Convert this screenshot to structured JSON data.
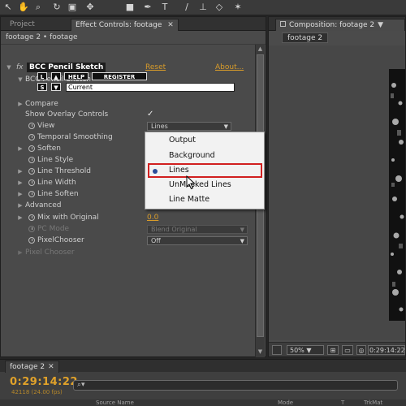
{
  "toolbar": {
    "tools": [
      {
        "icon": "selection-tool-icon",
        "glyph": "↖"
      },
      {
        "icon": "hand-tool-icon",
        "glyph": "✋"
      },
      {
        "icon": "zoom-tool-icon",
        "glyph": "⌕"
      },
      {
        "icon": "rotate-tool-icon",
        "glyph": "↻"
      },
      {
        "icon": "camera-tool-icon",
        "glyph": "▣"
      },
      {
        "icon": "pan-behind-tool-icon",
        "glyph": "✥"
      },
      {
        "icon": "rectangle-tool-icon",
        "glyph": "■"
      },
      {
        "icon": "pen-tool-icon",
        "glyph": "✒"
      },
      {
        "icon": "type-tool-icon",
        "glyph": "T"
      },
      {
        "icon": "brush-tool-icon",
        "glyph": "∕"
      },
      {
        "icon": "clone-stamp-tool-icon",
        "glyph": "⊥"
      },
      {
        "icon": "eraser-tool-icon",
        "glyph": "◇"
      },
      {
        "icon": "puppet-tool-icon",
        "glyph": "✶"
      }
    ]
  },
  "left_panel": {
    "tabs": {
      "project": "Project",
      "effect_controls": "Effect Controls: footage"
    },
    "breadcrumb": "footage 2 • footage",
    "effect": {
      "fx_label": "fx",
      "name": "BCC Pencil Sketch",
      "reset": "Reset",
      "about": "About...",
      "subtitle": "BCC Pencil Sketch",
      "btn_l": "L",
      "btn_up": "▲",
      "btn_help": "HELP",
      "btn_register": "REGISTER",
      "btn_s": "S",
      "btn_down": "▼",
      "current_field": "Current"
    },
    "properties": {
      "compare": "Compare",
      "show_overlay_controls": "Show Overlay Controls",
      "overlay_checked": "✓",
      "view": "View",
      "view_value": "Lines",
      "temporal_smoothing": "Temporal Smoothing",
      "soften": "Soften",
      "line_style": "Line Style",
      "line_threshold": "Line Threshold",
      "line_width": "Line Width",
      "line_soften": "Line Soften",
      "advanced": "Advanced",
      "mix_with_original": "Mix with Original",
      "mix_value": "0.0",
      "pc_mode": "PC Mode",
      "pc_mode_value": "Blend Original",
      "pixel_chooser": "PixelChooser",
      "pixel_chooser_value": "Off",
      "pixel_chooser_group": "Pixel Chooser"
    }
  },
  "dropdown": {
    "options": [
      "Output",
      "Background",
      "Lines",
      "UnMasked Lines",
      "Line Matte"
    ],
    "selected": "Lines"
  },
  "right_panel": {
    "tab": "Composition: footage 2",
    "footage_tab": "footage 2",
    "zoom": "50%",
    "timecode": "0:29:14:22"
  },
  "timeline": {
    "tab": "footage 2",
    "timecode": "0:29:14:22",
    "frames": "42118 (24.00 fps)",
    "search_placeholder": "",
    "columns": {
      "source_name": "Source Name",
      "mode": "Mode",
      "t": "T",
      "trkmat": "TrkMat"
    }
  },
  "colors": {
    "accent_orange": "#d89c2a",
    "highlight_red": "#d12020",
    "panel_gray": "#4a4a4a"
  }
}
